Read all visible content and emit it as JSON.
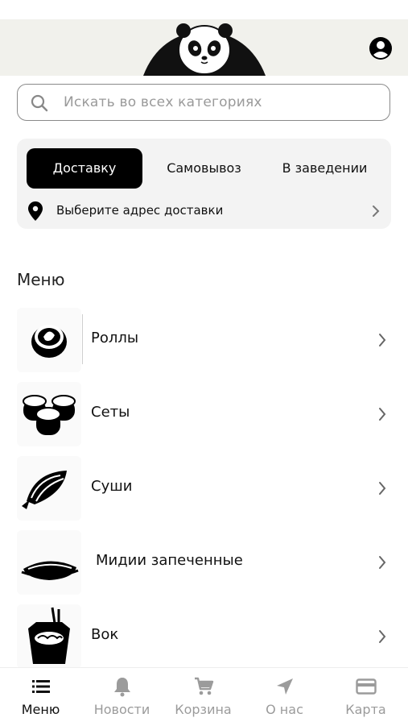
{
  "search": {
    "placeholder": "Искать во всех категориях"
  },
  "delivery_modes": [
    {
      "label": "Доставку",
      "active": true
    },
    {
      "label": "Самовывоз",
      "active": false
    },
    {
      "label": "В заведении",
      "active": false
    }
  ],
  "address": {
    "label": "Выберите адрес доставки"
  },
  "menu": {
    "title": "Меню",
    "items": [
      {
        "label": "Роллы",
        "icon": "roll-icon"
      },
      {
        "label": "Сеты",
        "icon": "sushi-set-icon"
      },
      {
        "label": "Суши",
        "icon": "sushi-fish-icon"
      },
      {
        "label": "Мидии запеченные",
        "icon": "mussels-icon"
      },
      {
        "label": "Вок",
        "icon": "wok-box-icon"
      }
    ]
  },
  "tabbar": [
    {
      "label": "Меню",
      "icon": "list-icon",
      "active": true
    },
    {
      "label": "Новости",
      "icon": "bell-icon",
      "active": false
    },
    {
      "label": "Корзина",
      "icon": "cart-icon",
      "active": false
    },
    {
      "label": "О нас",
      "icon": "navigation-arrow-icon",
      "active": false
    },
    {
      "label": "Карта",
      "icon": "card-icon",
      "active": false
    }
  ],
  "colors": {
    "header_bg": "#f1f1ec",
    "active_tab_bg": "#000000",
    "inactive_tab_text": "#9b9b9b"
  }
}
